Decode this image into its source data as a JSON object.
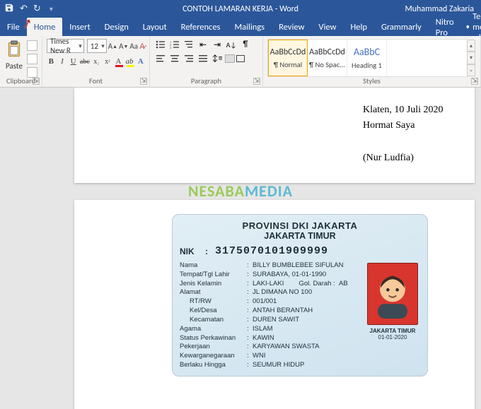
{
  "title_bar": {
    "doc_title": "CONTOH LAMARAN KERJA  -  Word",
    "user": "Muhammad Zakaria"
  },
  "menu": {
    "file": "File",
    "home": "Home",
    "insert": "Insert",
    "design": "Design",
    "layout": "Layout",
    "references": "References",
    "mailings": "Mailings",
    "review": "Review",
    "view": "View",
    "help": "Help",
    "grammarly": "Grammarly",
    "nitro": "Nitro Pro",
    "tellme": "Tell me what"
  },
  "ribbon": {
    "clipboard": {
      "paste": "Paste",
      "label": "Clipboard"
    },
    "font": {
      "name": "Times New R",
      "size": "12",
      "label": "Font"
    },
    "paragraph": {
      "label": "Paragraph"
    },
    "styles": {
      "label": "Styles",
      "preview_text": "AaBbCcDd",
      "preview_heading": "AaBbC",
      "items": [
        {
          "name": "¶ Normal"
        },
        {
          "name": "¶ No Spac..."
        },
        {
          "name": "Heading 1"
        }
      ]
    }
  },
  "doc": {
    "place_date": "Klaten, 10 Juli 2020",
    "salutation": "Hormat Saya",
    "signature": "(Nur Ludfia)"
  },
  "watermark": {
    "part1": "NESABA",
    "part2": "MEDIA"
  },
  "ktp": {
    "province": "PROVINSI DKI JAKARTA",
    "city": "JAKARTA TIMUR",
    "nik_label": "NIK",
    "nik": "3175070101909999",
    "fields": {
      "nama_lbl": "Nama",
      "nama": "BILLY BUMBLEBEE SIFULAN",
      "ttl_lbl": "Tempat/Tgl Lahir",
      "ttl": "SURABAYA, 01-01-1990",
      "jk_lbl": "Jenis Kelamin",
      "jk": "LAKI-LAKI",
      "gol_lbl": "Gol. Darah :",
      "gol": "AB",
      "alamat_lbl": "Alamat",
      "alamat": "JL DIMANA NO 100",
      "rtrw_lbl": "RT/RW",
      "rtrw": "001/001",
      "keldesa_lbl": "Kel/Desa",
      "keldesa": "ANTAH BERANTAH",
      "kec_lbl": "Kecamatan",
      "kec": "DUREN SAWIT",
      "agama_lbl": "Agama",
      "agama": "ISLAM",
      "kawin_lbl": "Status Perkawinan",
      "kawin": "KAWIN",
      "pekerjaan_lbl": "Pekerjaan",
      "pekerjaan": "KARYAWAN SWASTA",
      "warga_lbl": "Kewarganegaraan",
      "warga": "WNI",
      "berlaku_lbl": "Berlaku Hingga",
      "berlaku": "SEUMUR HIDUP"
    },
    "photo_loc": "JAKARTA TIMUR",
    "photo_date": "01-01-2020"
  }
}
